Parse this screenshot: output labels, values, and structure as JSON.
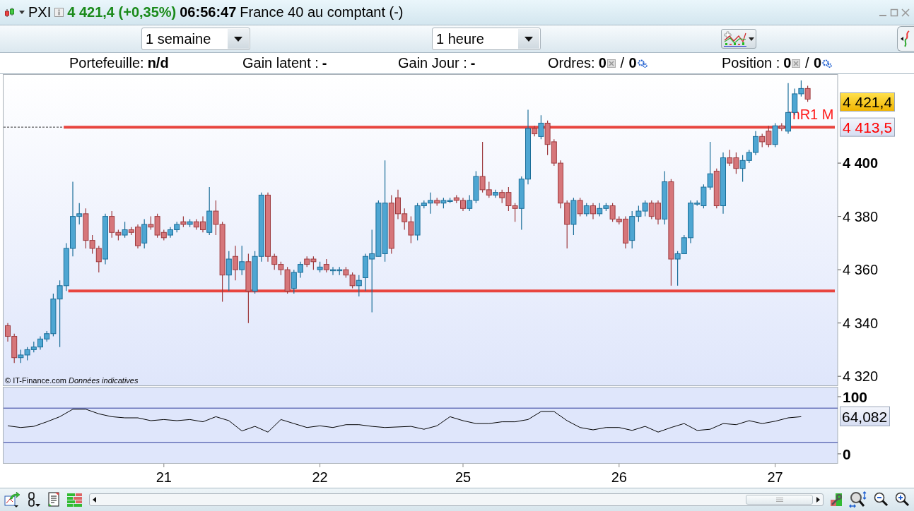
{
  "header": {
    "symbol": "PXI",
    "quote": "4 421,4 (+0,35%)",
    "time": "06:56:47",
    "name": "France 40 au comptant (-)"
  },
  "toolbar": {
    "dropdowns": [
      {
        "value": "1 semaine"
      },
      {
        "value": "1 heure"
      }
    ]
  },
  "stats": [
    {
      "kind": "text",
      "label": "Portefeuille:",
      "value": "n/d"
    },
    {
      "kind": "text",
      "label": "Gain latent :",
      "value": "-"
    },
    {
      "kind": "text",
      "label": "Gain Jour :",
      "value": "-"
    },
    {
      "kind": "counts",
      "label": "Ordres:",
      "values": [
        "0",
        "0"
      ],
      "separator": "/"
    },
    {
      "kind": "counts",
      "label": "Position :",
      "values": [
        "0",
        "0"
      ],
      "separator": "/"
    }
  ],
  "price_chart": {
    "last_price_tag": "4 421,4",
    "ref_line_tag": "4 413,5",
    "credit": "© IT-Finance.com",
    "credit_note": "Données indicatives",
    "chart_data": {
      "type": "candlestick",
      "ylim": [
        4316.6,
        4433.4
      ],
      "yticks": [
        {
          "value": 4320,
          "label": "4 320"
        },
        {
          "value": 4340,
          "label": "4 340"
        },
        {
          "value": 4360,
          "label": "4 360"
        },
        {
          "value": 4380,
          "label": "4 380"
        },
        {
          "value": 4400,
          "label": "4 400"
        }
      ],
      "categories": [
        null,
        null,
        null,
        null,
        null,
        null,
        null,
        null,
        null,
        null,
        null,
        null,
        null,
        null,
        null,
        null,
        null,
        null,
        null,
        null,
        null,
        null,
        null,
        null,
        null,
        null,
        null,
        null,
        null,
        null,
        null,
        null,
        null,
        null,
        null,
        null,
        null,
        null,
        null,
        null,
        null,
        null,
        null,
        null,
        null,
        null,
        null,
        null,
        null,
        null,
        null,
        null,
        null,
        null,
        null,
        null,
        null,
        null,
        null,
        null,
        null,
        null,
        null,
        null,
        null,
        null,
        null,
        null,
        null,
        null,
        null,
        null,
        null,
        null,
        null,
        null,
        null,
        null,
        null,
        null,
        null,
        null,
        null,
        null,
        null,
        null,
        null,
        null,
        null,
        null,
        null,
        null,
        null,
        null,
        null,
        null,
        null,
        null,
        null,
        null,
        null,
        null,
        null,
        null,
        null,
        null,
        null,
        null,
        null,
        null,
        null,
        null,
        null,
        null,
        null,
        null,
        null,
        null,
        null,
        null,
        null,
        null,
        null,
        null
      ],
      "ohlc": [
        [
          4339,
          4340,
          4333,
          4335
        ],
        [
          4335,
          4336,
          4325,
          4327
        ],
        [
          4327,
          4330,
          4325,
          4328
        ],
        [
          4328,
          4331,
          4326,
          4330
        ],
        [
          4330,
          4333,
          4329,
          4331
        ],
        [
          4331,
          4335,
          4330,
          4334
        ],
        [
          4334,
          4337,
          4333,
          4336
        ],
        [
          4336,
          4351,
          4335,
          4349
        ],
        [
          4349,
          4356,
          4331,
          4354
        ],
        [
          4354,
          4370,
          4352,
          4368
        ],
        [
          4368,
          4393,
          4365,
          4380
        ],
        [
          4380,
          4385,
          4377,
          4381
        ],
        [
          4381,
          4383,
          4368,
          4371
        ],
        [
          4371,
          4373,
          4366,
          4368
        ],
        [
          4368,
          4369,
          4359,
          4363
        ],
        [
          4364,
          4381,
          4362,
          4380
        ],
        [
          4380,
          4382,
          4372,
          4374
        ],
        [
          4374,
          4375,
          4371,
          4373
        ],
        [
          4373,
          4378,
          4372,
          4375
        ],
        [
          4375,
          4376,
          4373,
          4374
        ],
        [
          4376,
          4377,
          4368,
          4369
        ],
        [
          4370,
          4379,
          4368,
          4377
        ],
        [
          4377,
          4380,
          4375,
          4376
        ],
        [
          4380,
          4381,
          4372,
          4373
        ],
        [
          4374,
          4375,
          4371,
          4372
        ],
        [
          4373,
          4376,
          4372,
          4375
        ],
        [
          4375,
          4378,
          4374,
          4377
        ],
        [
          4378,
          4380,
          4376,
          4377
        ],
        [
          4377,
          4379,
          4376,
          4378
        ],
        [
          4378,
          4379,
          4375,
          4376
        ],
        [
          4378,
          4380,
          4374,
          4375
        ],
        [
          4374,
          4391,
          4373,
          4382
        ],
        [
          4382,
          4386,
          4373,
          4377
        ],
        [
          4377,
          4378,
          4348,
          4358
        ],
        [
          4358,
          4367,
          4352,
          4364
        ],
        [
          4365,
          4369,
          4356,
          4360
        ],
        [
          4360,
          4369,
          4358,
          4363
        ],
        [
          4363,
          4366,
          4340,
          4352
        ],
        [
          4352,
          4367,
          4351,
          4365
        ],
        [
          4365,
          4389,
          4363,
          4388
        ],
        [
          4388,
          4389,
          4363,
          4365
        ],
        [
          4365,
          4366,
          4360,
          4362
        ],
        [
          4362,
          4363,
          4358,
          4360
        ],
        [
          4360,
          4361,
          4351,
          4352
        ],
        [
          4353,
          4360,
          4351,
          4359
        ],
        [
          4359,
          4363,
          4357,
          4362
        ],
        [
          4364,
          4365,
          4361,
          4362
        ],
        [
          4364,
          4365,
          4360,
          4363
        ],
        [
          4360,
          4363,
          4359,
          4361
        ],
        [
          4362,
          4364,
          4359,
          4360
        ],
        [
          4360,
          4361,
          4358,
          4360
        ],
        [
          4360,
          4361,
          4358,
          4360
        ],
        [
          4360,
          4361,
          4357,
          4358
        ],
        [
          4358,
          4359,
          4353,
          4354
        ],
        [
          4354,
          4358,
          4350,
          4356
        ],
        [
          4357,
          4366,
          4352,
          4365
        ],
        [
          4364,
          4375,
          4344,
          4366
        ],
        [
          4365,
          4386,
          4365,
          4385
        ],
        [
          4366,
          4401,
          4363,
          4385
        ],
        [
          4385,
          4388,
          4366,
          4368
        ],
        [
          4387,
          4390,
          4379,
          4381
        ],
        [
          4381,
          4383,
          4375,
          4378
        ],
        [
          4378,
          4380,
          4370,
          4373
        ],
        [
          4373,
          4385,
          4371,
          4384
        ],
        [
          4384,
          4386,
          4383,
          4385
        ],
        [
          4385,
          4389,
          4381,
          4386
        ],
        [
          4386,
          4387,
          4384,
          4385
        ],
        [
          4385,
          4387,
          4383,
          4386
        ],
        [
          4386,
          4387,
          4385,
          4386
        ],
        [
          4387,
          4388,
          4385,
          4386
        ],
        [
          4386,
          4387,
          4382,
          4383
        ],
        [
          4383,
          4388,
          4382,
          4386
        ],
        [
          4386,
          4397,
          4385,
          4395
        ],
        [
          4395,
          4408,
          4389,
          4390
        ],
        [
          4390,
          4393,
          4387,
          4388
        ],
        [
          4388,
          4390,
          4387,
          4389
        ],
        [
          4389,
          4390,
          4385,
          4387
        ],
        [
          4389,
          4391,
          4382,
          4384
        ],
        [
          4384,
          4385,
          4378,
          4383
        ],
        [
          4383,
          4395,
          4375,
          4394
        ],
        [
          4394,
          4420,
          4392,
          4413
        ],
        [
          4413,
          4414,
          4410,
          4411
        ],
        [
          4410,
          4418,
          4409,
          4415
        ],
        [
          4415,
          4416,
          4403,
          4407
        ],
        [
          4408,
          4409,
          4399,
          4400
        ],
        [
          4400,
          4401,
          4383,
          4385
        ],
        [
          4385,
          4386,
          4368,
          4377
        ],
        [
          4377,
          4387,
          4373,
          4386
        ],
        [
          4386,
          4387,
          4380,
          4381
        ],
        [
          4381,
          4385,
          4380,
          4384
        ],
        [
          4384,
          4385,
          4379,
          4381
        ],
        [
          4381,
          4385,
          4380,
          4383
        ],
        [
          4383,
          4385,
          4382,
          4384
        ],
        [
          4384,
          4385,
          4378,
          4379
        ],
        [
          4379,
          4380,
          4377,
          4378
        ],
        [
          4379,
          4380,
          4368,
          4370
        ],
        [
          4371,
          4382,
          4368,
          4380
        ],
        [
          4380,
          4384,
          4378,
          4382
        ],
        [
          4382,
          4386,
          4380,
          4385
        ],
        [
          4385,
          4386,
          4379,
          4380
        ],
        [
          4385,
          4386,
          4377,
          4379
        ],
        [
          4379,
          4397,
          4377,
          4393
        ],
        [
          4393,
          4394,
          4354,
          4364
        ],
        [
          4364,
          4367,
          4354,
          4366
        ],
        [
          4366,
          4373,
          4366,
          4372
        ],
        [
          4372,
          4386,
          4370,
          4385
        ],
        [
          4385,
          4386,
          4384,
          4385
        ],
        [
          4384,
          4392,
          4383,
          4391
        ],
        [
          4391,
          4408,
          4390,
          4396
        ],
        [
          4397,
          4398,
          4383,
          4384
        ],
        [
          4384,
          4404,
          4381,
          4402
        ],
        [
          4402,
          4405,
          4399,
          4400
        ],
        [
          4402,
          4404,
          4396,
          4398
        ],
        [
          4398,
          4403,
          4393,
          4401
        ],
        [
          4401,
          4405,
          4400,
          4404
        ],
        [
          4404,
          4412,
          4403,
          4410
        ],
        [
          4410,
          4411,
          4406,
          4408
        ],
        [
          4412,
          4414,
          4406,
          4407
        ],
        [
          4407,
          4415,
          4406,
          4414
        ],
        [
          4414,
          4415,
          4412,
          4413
        ],
        [
          4412,
          4430,
          4411,
          4419
        ],
        [
          4419,
          4428,
          4418,
          4426
        ],
        [
          4426,
          4431,
          4425,
          4428
        ],
        [
          4428,
          4429,
          4423,
          4424
        ]
      ],
      "ref_lines": [
        {
          "axis": "y",
          "value": 4413.5,
          "label": "mR1 M"
        },
        {
          "axis": "y",
          "value": 4352
        }
      ]
    }
  },
  "indicator_chart": {
    "value_tag": "64,082",
    "chart_data": {
      "type": "line",
      "ylim": [
        -16.7,
        116.7
      ],
      "yticks": [
        0,
        100
      ],
      "categories": [
        null,
        null,
        null,
        null,
        null,
        null,
        null,
        null,
        null,
        null,
        null,
        null,
        "21",
        null,
        null,
        null,
        null,
        null,
        null,
        null,
        null,
        null,
        null,
        null,
        "22",
        null,
        null,
        null,
        null,
        null,
        null,
        null,
        null,
        null,
        null,
        "25",
        null,
        null,
        null,
        null,
        null,
        null,
        null,
        null,
        null,
        null,
        null,
        "26",
        null,
        null,
        null,
        null,
        null,
        null,
        null,
        null,
        null,
        null,
        null,
        "27",
        null,
        null
      ],
      "series": [
        {
          "color": "#000000",
          "values": [
            49,
            46,
            48,
            56,
            65,
            78,
            78,
            70,
            65,
            63,
            63,
            58,
            60,
            58,
            60,
            56,
            65,
            58,
            40,
            48,
            38,
            60,
            53,
            46,
            49,
            46,
            51,
            51,
            48,
            46,
            47,
            48,
            43,
            49,
            65,
            58,
            53,
            53,
            56,
            56,
            60,
            74,
            74,
            58,
            46,
            42,
            46,
            46,
            41,
            48,
            38,
            46,
            53,
            41,
            43,
            53,
            51,
            58,
            53,
            57,
            63,
            65
          ]
        }
      ],
      "ref_lines": [
        {
          "axis": "y",
          "value": 80
        },
        {
          "axis": "y",
          "value": 20
        }
      ]
    }
  }
}
